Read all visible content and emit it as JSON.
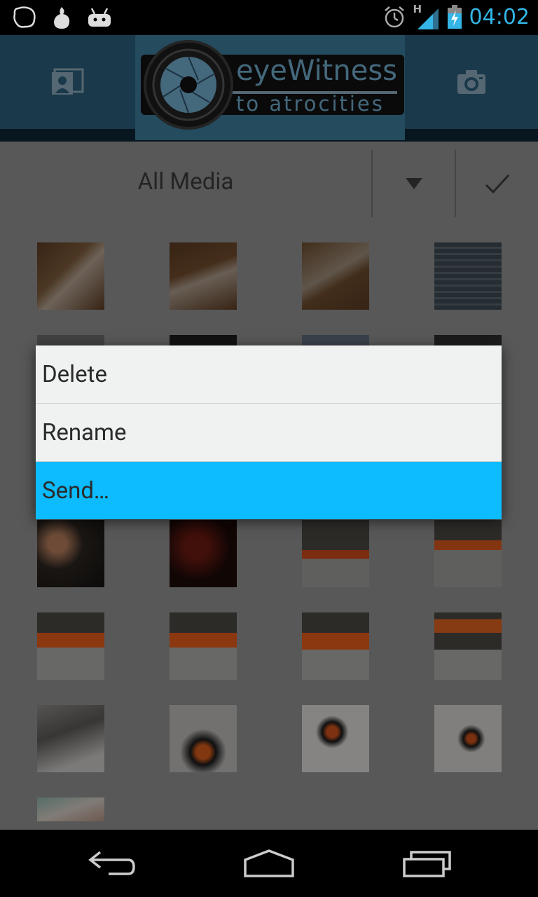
{
  "status_bar": {
    "time": "04:02",
    "network_type": "H",
    "icons": [
      "chat-bubble-icon",
      "fire-icon",
      "android-icon",
      "alarm-icon",
      "signal-icon",
      "battery-charging-icon"
    ],
    "accent_color": "#33b5e5"
  },
  "header": {
    "logo_title": "eyeWitness",
    "logo_subtitle": "to atrocities",
    "left_tab_icon": "gallery-person-icon",
    "right_tab_icon": "camera-icon"
  },
  "filter_bar": {
    "label": "All Media",
    "dropdown_icon": "dropdown-triangle-icon",
    "confirm_icon": "checkmark-icon"
  },
  "context_menu": {
    "items": [
      {
        "label": "Delete"
      },
      {
        "label": "Rename"
      },
      {
        "label": "Send…"
      }
    ],
    "selected_index": 2,
    "selected_color": "#0cbcff"
  },
  "navigation_bar": {
    "icons": [
      "back-icon",
      "home-icon",
      "recent-apps-icon"
    ]
  }
}
